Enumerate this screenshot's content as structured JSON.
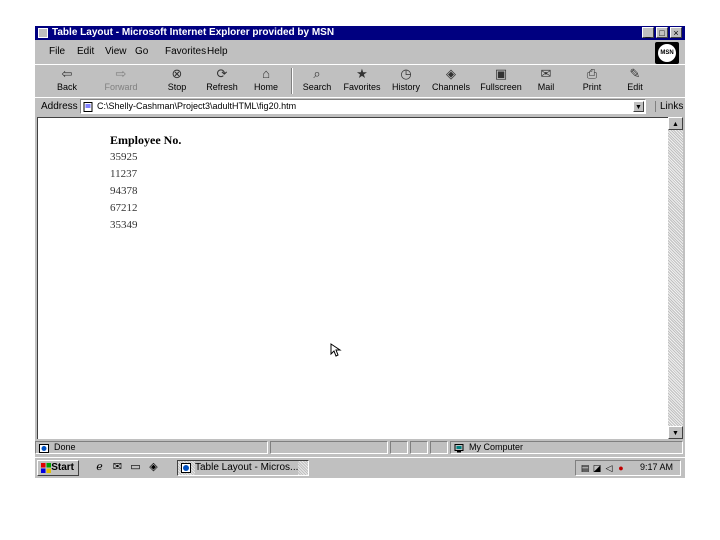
{
  "window": {
    "title": "Table Layout - Microsoft Internet Explorer provided by MSN",
    "controls": {
      "minimize": "_",
      "maximize": "□",
      "close": "×"
    }
  },
  "menu": [
    "File",
    "Edit",
    "View",
    "Go",
    "Favorites",
    "Help"
  ],
  "msn_logo": "MSN",
  "toolbar": [
    {
      "label": "Back",
      "icon": "back-arrow-icon",
      "glyph": "⇦",
      "disabled": false
    },
    {
      "label": "Forward",
      "icon": "forward-arrow-icon",
      "glyph": "⇨",
      "disabled": true
    },
    {
      "label": "Stop",
      "icon": "stop-icon",
      "glyph": "⊗",
      "disabled": false
    },
    {
      "label": "Refresh",
      "icon": "refresh-icon",
      "glyph": "⟳",
      "disabled": false
    },
    {
      "label": "Home",
      "icon": "home-icon",
      "glyph": "⌂",
      "disabled": false
    },
    {
      "label": "Search",
      "icon": "search-icon",
      "glyph": "⌕",
      "disabled": false
    },
    {
      "label": "Favorites",
      "icon": "favorites-icon",
      "glyph": "★",
      "disabled": false
    },
    {
      "label": "History",
      "icon": "history-icon",
      "glyph": "◷",
      "disabled": false
    },
    {
      "label": "Channels",
      "icon": "channels-icon",
      "glyph": "◈",
      "disabled": false
    },
    {
      "label": "Fullscreen",
      "icon": "fullscreen-icon",
      "glyph": "▣",
      "disabled": false
    },
    {
      "label": "Mail",
      "icon": "mail-icon",
      "glyph": "✉",
      "disabled": false
    },
    {
      "label": "Print",
      "icon": "print-icon",
      "glyph": "⎙",
      "disabled": false
    },
    {
      "label": "Edit",
      "icon": "edit-icon",
      "glyph": "✎",
      "disabled": false
    }
  ],
  "address": {
    "label": "Address",
    "value": "C:\\Shelly-Cashman\\Project3\\adultHTML\\fig20.htm",
    "links_label": "Links"
  },
  "page": {
    "table_header": "Employee No.",
    "rows": [
      "35925",
      "11237",
      "94378",
      "67212",
      "35349"
    ]
  },
  "status": {
    "text": "Done",
    "zone": "My Computer"
  },
  "taskbar": {
    "start": "Start",
    "task_button": "Table Layout - Micros...",
    "clock": "9:17 AM"
  }
}
